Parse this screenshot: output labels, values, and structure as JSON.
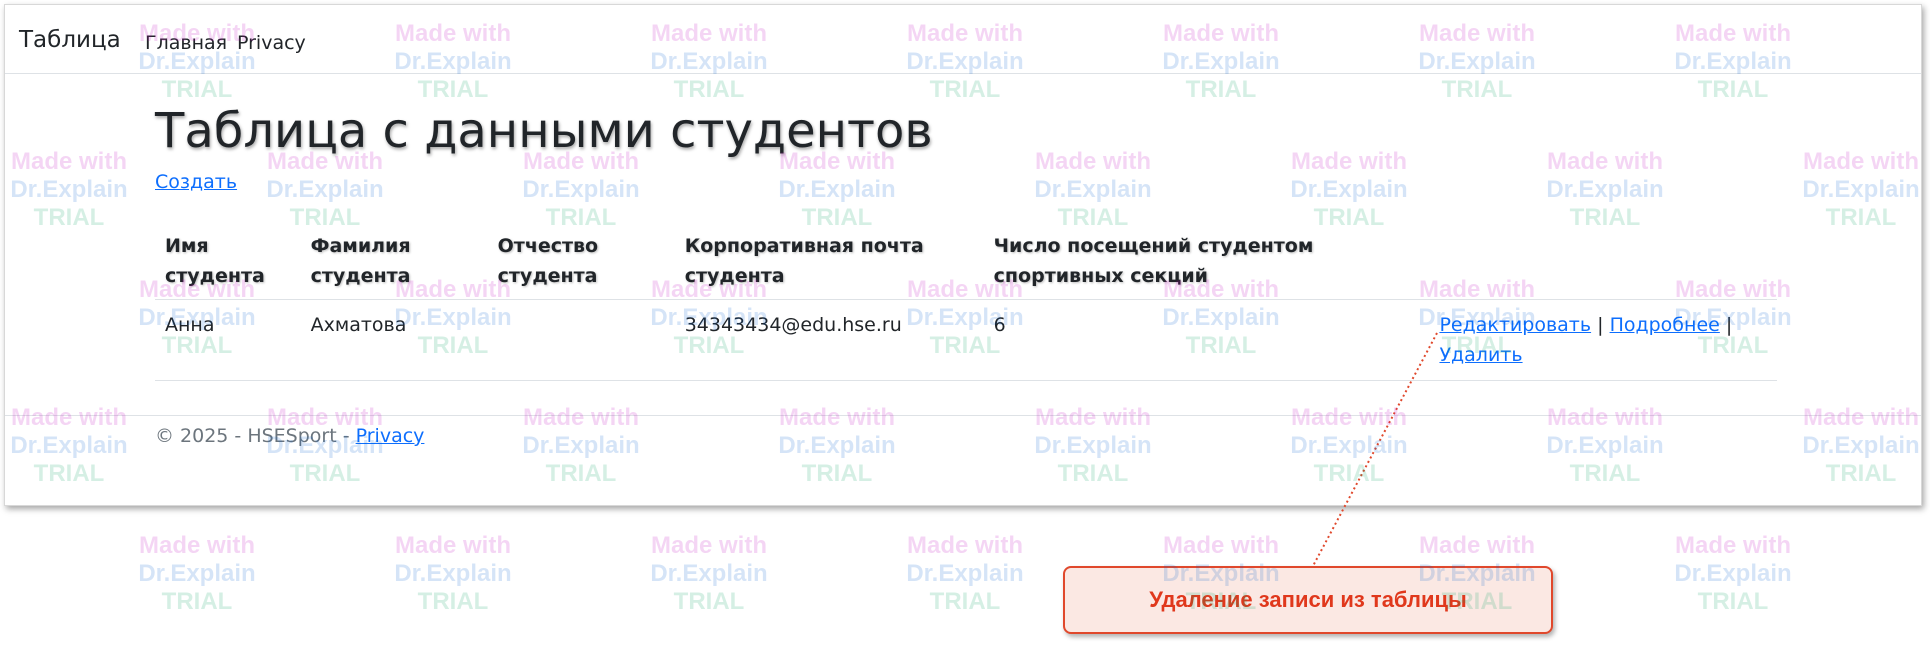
{
  "navbar": {
    "brand": "Таблица",
    "links": [
      {
        "label": "Главная"
      },
      {
        "label": "Privacy"
      }
    ]
  },
  "page": {
    "title": "Таблица с данными студентов",
    "create_link": "Создать"
  },
  "table": {
    "headers": [
      "Имя студента",
      "Фамилия студента",
      "Отчество студента",
      "Корпоративная почта студента",
      "Число посещений студентом спортивных секций",
      ""
    ],
    "rows": [
      {
        "first_name": "Анна",
        "last_name": "Ахматова",
        "middle_name": "",
        "email": "34343434@edu.hse.ru",
        "visits": "6",
        "actions": {
          "edit": "Редактировать",
          "details": "Подробнее",
          "delete": "Удалить",
          "separator": "|"
        }
      }
    ]
  },
  "footer": {
    "text": "© 2025 - HSESport - ",
    "privacy_link": "Privacy"
  },
  "callout": {
    "text": "Удаление записи из таблицы",
    "border_color": "#e0482c",
    "fill_color": "#fbe8e3",
    "text_color": "#e0381c"
  },
  "watermark": {
    "line1": "Made with",
    "line2": "Dr.Explain",
    "line3": "TRIAL"
  },
  "colors": {
    "link": "#0d6efd",
    "text": "#212529",
    "muted": "#6c757d",
    "border": "#dee2e6"
  }
}
